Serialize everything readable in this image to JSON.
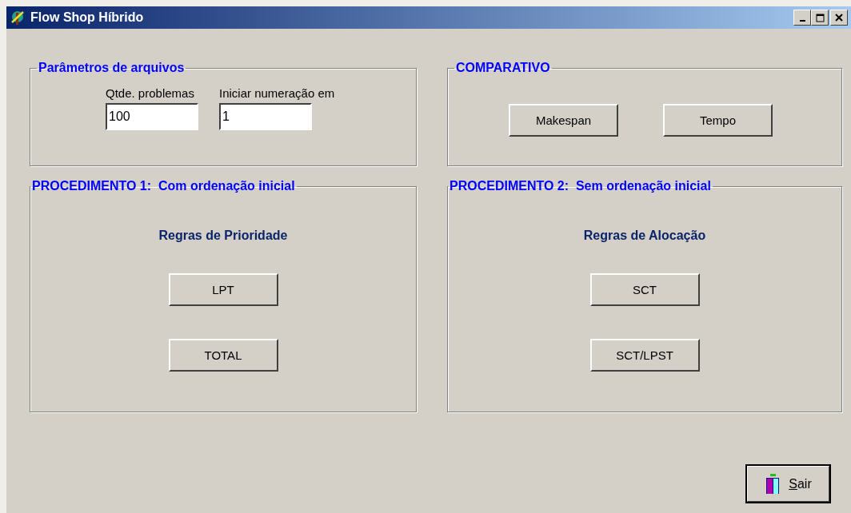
{
  "window": {
    "title": "Flow Shop Híbrido"
  },
  "file_params": {
    "legend": "Parâmetros de arquivos",
    "fields": [
      {
        "label": "Qtde. problemas",
        "value": "100"
      },
      {
        "label": "Iniciar numeração em",
        "value": "1"
      }
    ]
  },
  "comparativo": {
    "legend": "COMPARATIVO",
    "buttons": [
      "Makespan",
      "Tempo"
    ]
  },
  "procedures": [
    {
      "legend": "PROCEDIMENTO 1:  Com ordenação inicial",
      "heading": "Regras de Prioridade",
      "buttons": [
        "LPT",
        "TOTAL"
      ]
    },
    {
      "legend": "PROCEDIMENTO 2:  Sem ordenação inicial",
      "heading": "Regras de Alocação",
      "buttons": [
        "SCT",
        "SCT/LPST"
      ]
    }
  ],
  "exit_button": {
    "label": "Sair",
    "focused": true
  }
}
